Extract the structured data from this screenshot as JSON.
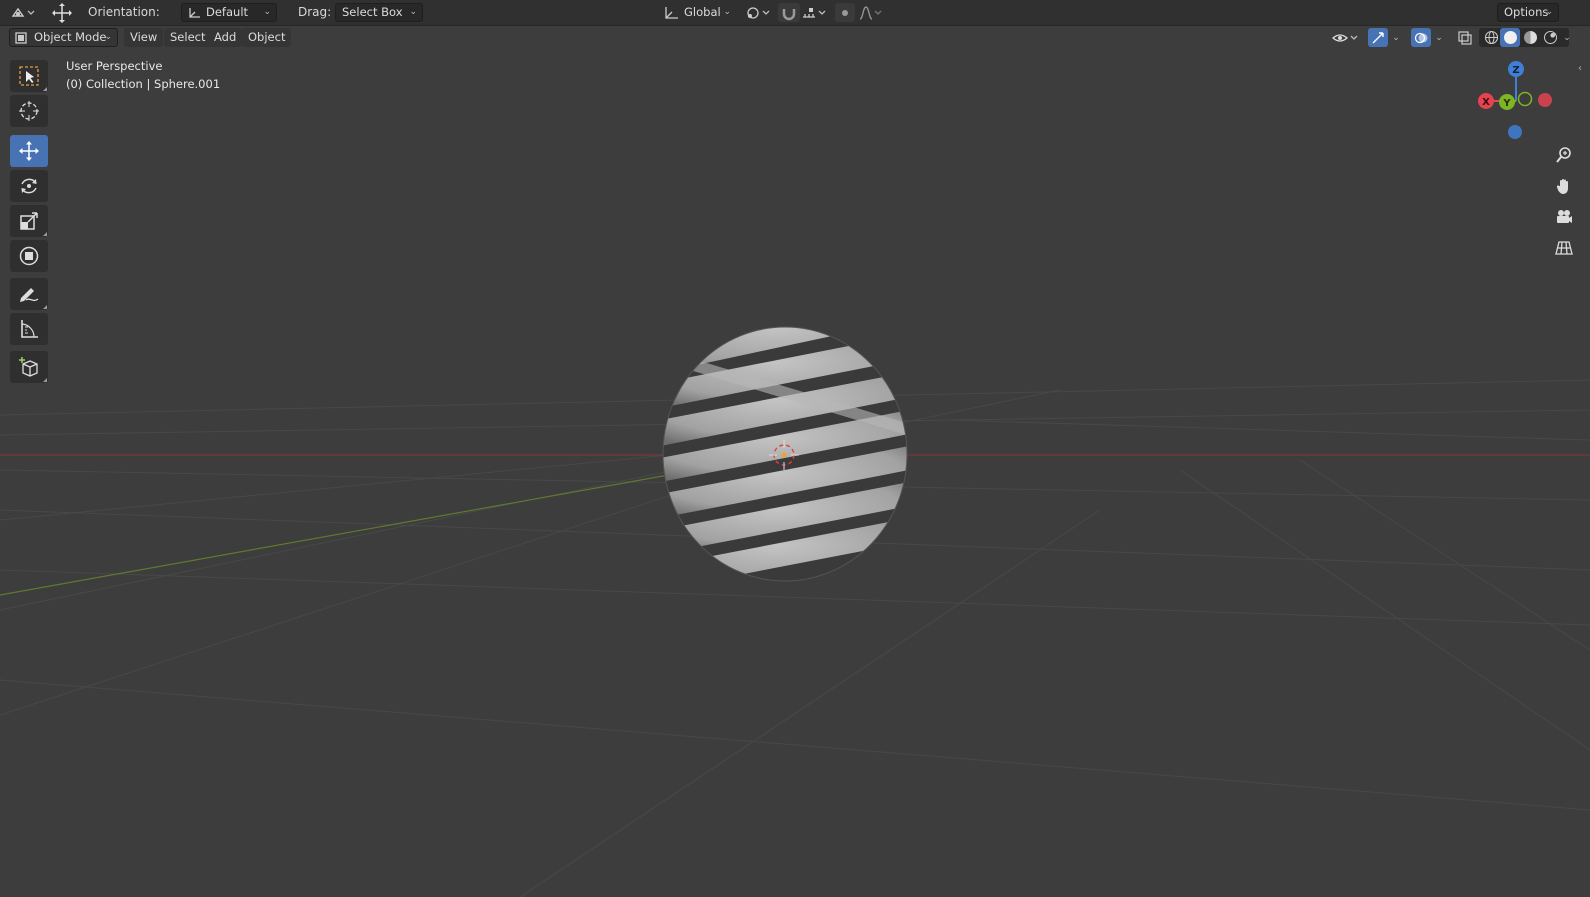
{
  "header": {
    "orientation_label": "Orientation:",
    "orientation_value": "Default",
    "drag_label": "Drag:",
    "drag_value": "Select Box",
    "transform_orientation": "Global",
    "options_label": "Options"
  },
  "viewport_header": {
    "mode": "Object Mode",
    "menus": [
      "View",
      "Select",
      "Add",
      "Object"
    ]
  },
  "toolbar": {
    "tools": [
      "select-box",
      "cursor",
      "move",
      "rotate",
      "scale",
      "transform",
      "annotate",
      "measure",
      "add-cube"
    ],
    "active_tool": "move",
    "accent_color": "#4772b3"
  },
  "viewport_overlay": {
    "perspective": "User Perspective",
    "collection_info": "(0) Collection | Sphere.001"
  },
  "gizmo": {
    "axes": [
      "Z",
      "X",
      "Y"
    ],
    "colors": {
      "x": "#e5434f",
      "y": "#7db523",
      "z": "#3f7fd6"
    }
  },
  "navigation": [
    "zoom-icon",
    "pan-hand-icon",
    "camera-icon",
    "grid-view-icon"
  ],
  "scene": {
    "object": "Sphere.001",
    "grid_color": "#4a4a4a",
    "x_axis_color": "#8a3a3a",
    "y_axis_color": "#5f7a2e"
  }
}
